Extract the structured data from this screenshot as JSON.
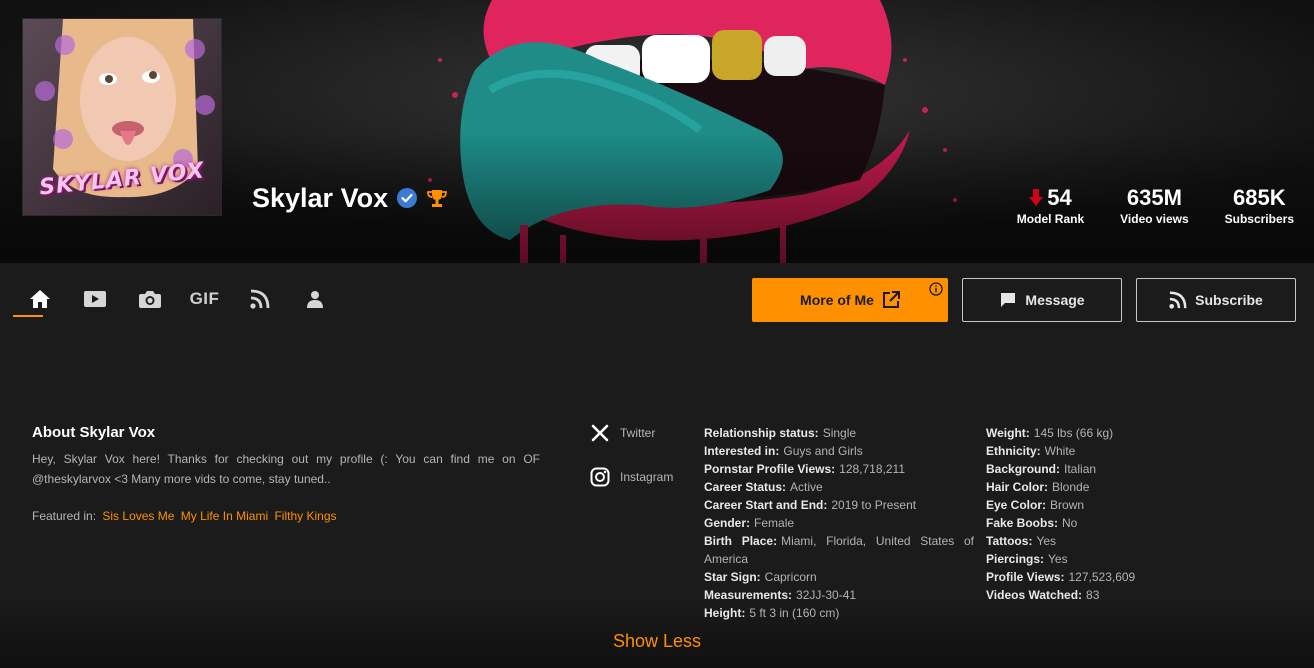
{
  "profile": {
    "name": "Skylar Vox",
    "avatar_caption": "SKYLAR VOX"
  },
  "stats": [
    {
      "value": "54",
      "label": "Model Rank"
    },
    {
      "value": "635M",
      "label": "Video views"
    },
    {
      "value": "685K",
      "label": "Subscribers"
    }
  ],
  "nav": {
    "tabs": [
      "home",
      "videos",
      "photos",
      "GIF",
      "feed",
      "profile"
    ],
    "gif_label": "GIF"
  },
  "buttons": {
    "more_of_me": "More of Me",
    "message": "Message",
    "subscribe": "Subscribe"
  },
  "about": {
    "title": "About Skylar Vox",
    "text": "Hey, Skylar Vox here! Thanks for checking out my profile (: You can find me on OF @theskylarvox <3 Many more vids to come, stay tuned..",
    "featured_label": "Featured in:",
    "featured_links": [
      "Sis Loves Me",
      "My Life In Miami",
      "Filthy Kings"
    ]
  },
  "socials": [
    {
      "label": "Twitter",
      "icon": "x-twitter-icon"
    },
    {
      "label": "Instagram",
      "icon": "instagram-icon"
    }
  ],
  "details_left": [
    {
      "label": "Relationship status:",
      "value": "Single"
    },
    {
      "label": "Interested in:",
      "value": "Guys and Girls"
    },
    {
      "label": "Pornstar Profile Views:",
      "value": "128,718,211"
    },
    {
      "label": "Career Status:",
      "value": "Active"
    },
    {
      "label": "Career Start and End:",
      "value": "2019 to Present"
    },
    {
      "label": "Gender:",
      "value": "Female"
    },
    {
      "label": "Birth Place:",
      "value": "Miami, Florida, United States of America"
    },
    {
      "label": "Star Sign:",
      "value": "Capricorn"
    },
    {
      "label": "Measurements:",
      "value": "32JJ-30-41"
    },
    {
      "label": "Height:",
      "value": "5 ft 3 in (160 cm)"
    }
  ],
  "details_right": [
    {
      "label": "Weight:",
      "value": "145 lbs (66 kg)"
    },
    {
      "label": "Ethnicity:",
      "value": "White"
    },
    {
      "label": "Background:",
      "value": "Italian"
    },
    {
      "label": "Hair Color:",
      "value": "Blonde"
    },
    {
      "label": "Eye Color:",
      "value": "Brown"
    },
    {
      "label": "Fake Boobs:",
      "value": "No"
    },
    {
      "label": "Tattoos:",
      "value": "Yes"
    },
    {
      "label": "Piercings:",
      "value": "Yes"
    },
    {
      "label": "Profile Views:",
      "value": "127,523,609"
    },
    {
      "label": "Videos Watched:",
      "value": "83"
    }
  ],
  "show_less": "Show Less",
  "colors": {
    "accent": "#ff9000",
    "background": "#1b1b1b",
    "verified": "#3a7bd5",
    "rank_down": "#d0021b"
  }
}
